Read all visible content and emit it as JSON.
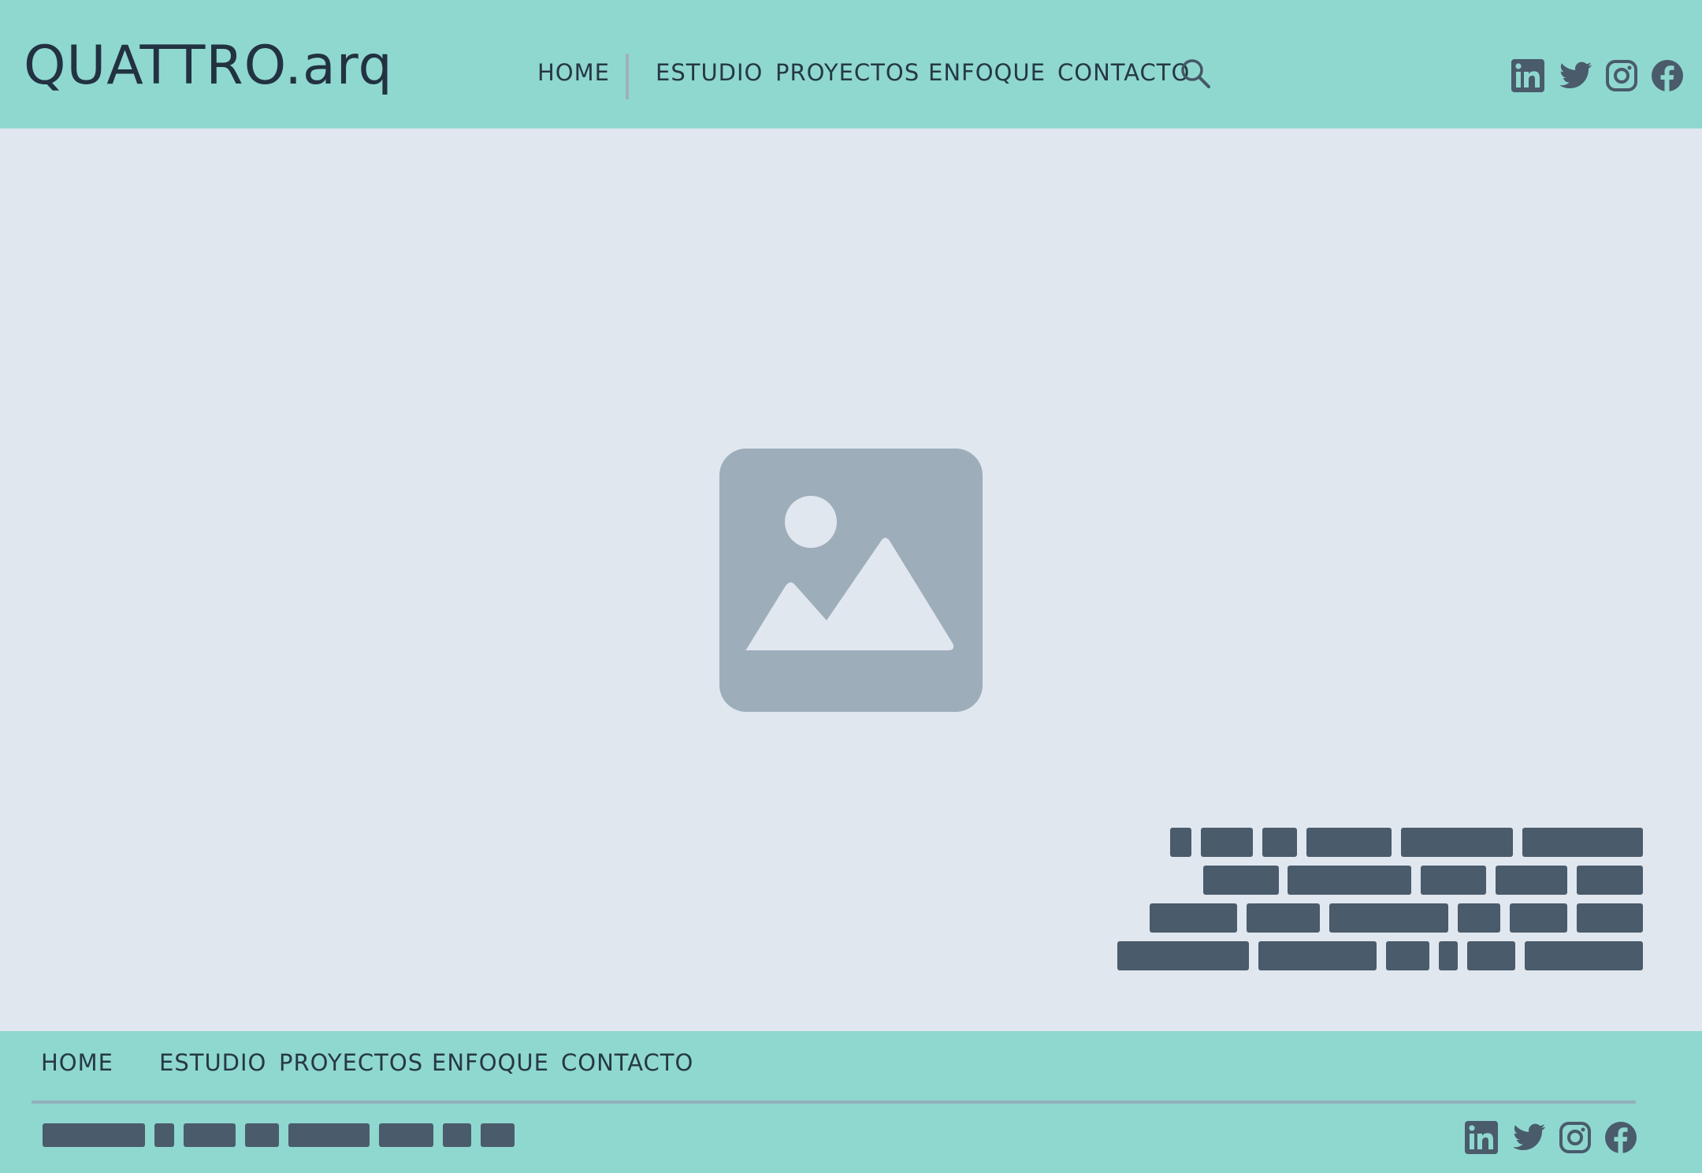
{
  "brand": {
    "logo_text": "QUATTRO.arq"
  },
  "header": {
    "nav": [
      {
        "label": "HOME"
      },
      {
        "label": "ESTUDIO"
      },
      {
        "label": "PROYECTOS"
      },
      {
        "label": "ENFOQUE"
      },
      {
        "label": "CONTACTO"
      }
    ],
    "search_icon": "search-icon",
    "social_icons": [
      "linkedin-icon",
      "twitter-icon",
      "instagram-icon",
      "facebook-icon"
    ]
  },
  "hero": {
    "image_icon": "image-placeholder-icon"
  },
  "footer": {
    "nav": [
      {
        "label": "HOME"
      },
      {
        "label": "ESTUDIO"
      },
      {
        "label": "PROYECTOS"
      },
      {
        "label": "ENFOQUE"
      },
      {
        "label": "CONTACTO"
      }
    ],
    "social_icons": [
      "linkedin-icon",
      "twitter-icon",
      "instagram-icon",
      "facebook-icon"
    ]
  },
  "colors": {
    "header_bg": "#8fd8cf",
    "hero_bg": "#e0e7ef",
    "text_dark": "#223241",
    "redacted_block": "#4a5b6b",
    "placeholder_icon": "#9eadba"
  }
}
